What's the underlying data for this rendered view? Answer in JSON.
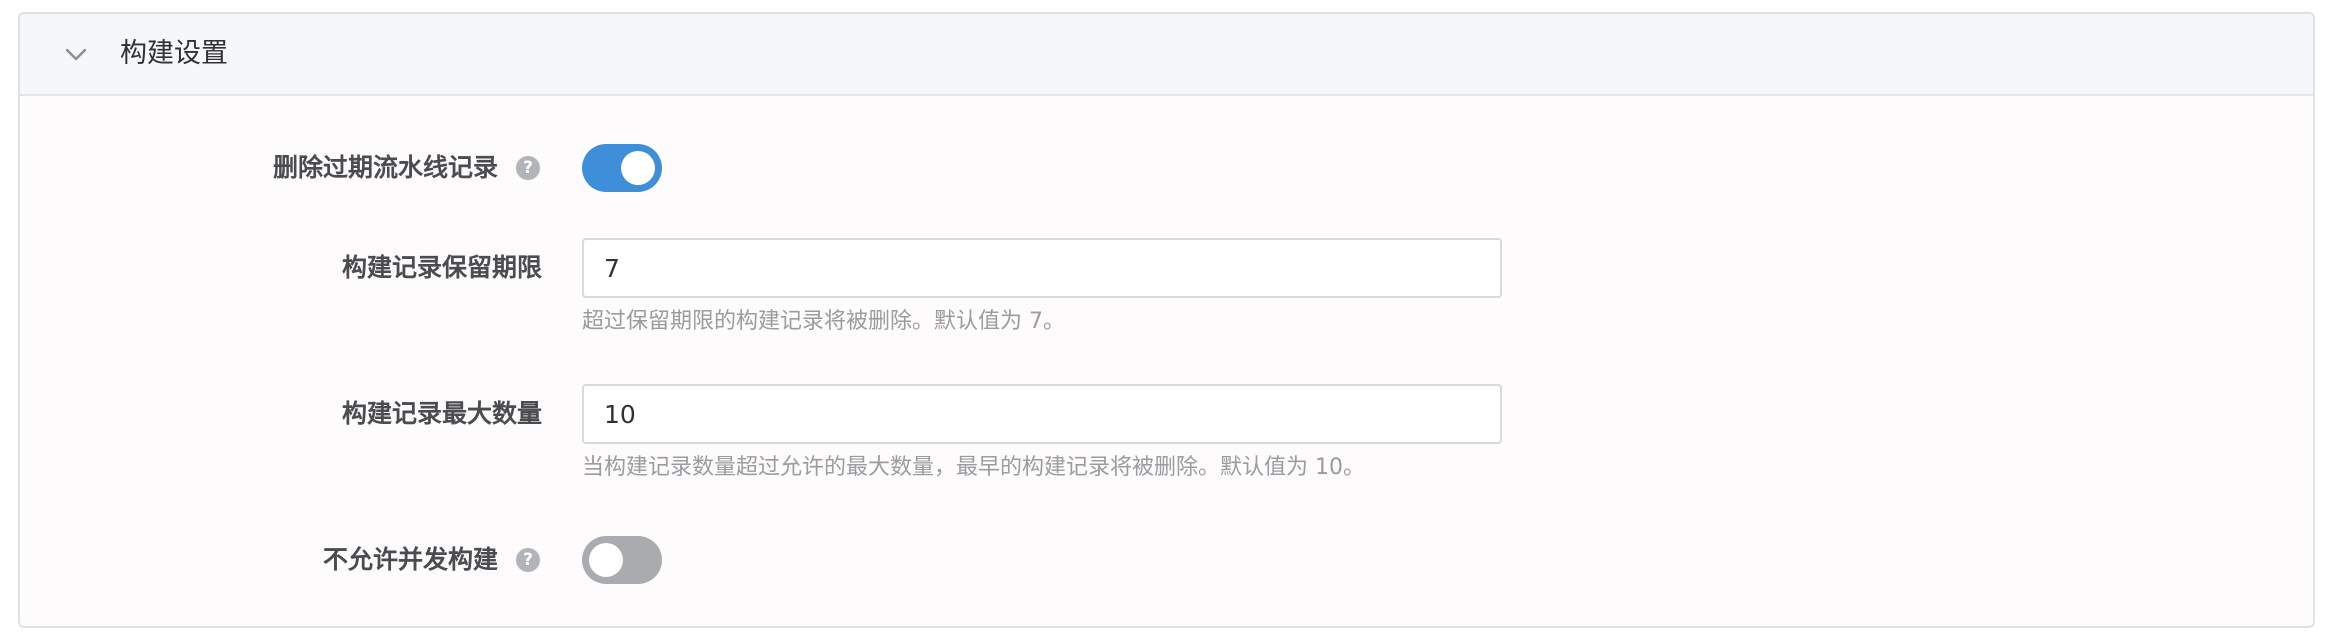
{
  "panel": {
    "title": "构建设置",
    "toggle_icon": "chevron-down-icon"
  },
  "settings": {
    "delete_expired": {
      "label": "删除过期流水线记录",
      "help_icon": "question-circle-icon",
      "help_glyph": "?",
      "enabled": true
    },
    "retention_days": {
      "label": "构建记录保留期限",
      "value": "7",
      "hint": "超过保留期限的构建记录将被删除。默认值为 7。"
    },
    "max_records": {
      "label": "构建记录最大数量",
      "value": "10",
      "hint": "当构建记录数量超过允许的最大数量，最早的构建记录将被删除。默认值为 10。"
    },
    "disallow_concurrent": {
      "label": "不允许并发构建",
      "help_icon": "question-circle-icon",
      "help_glyph": "?",
      "enabled": false
    }
  },
  "colors": {
    "toggle_on": "#3f8ed9",
    "toggle_off": "#a9abae"
  }
}
